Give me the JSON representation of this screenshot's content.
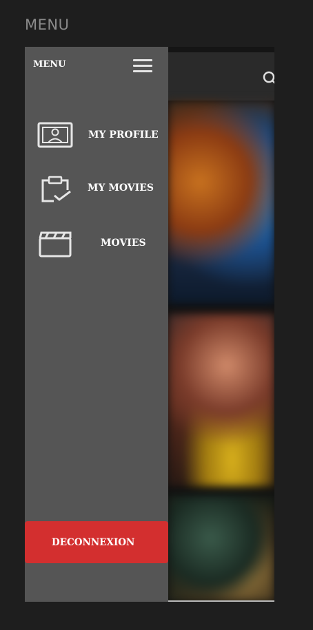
{
  "page": {
    "title": "MENU"
  },
  "drawer": {
    "title": "MENU",
    "items": [
      {
        "label": "MY PROFILE",
        "icon": "profile-card-icon"
      },
      {
        "label": "MY MOVIES",
        "icon": "clipboard-check-icon"
      },
      {
        "label": "MOVIES",
        "icon": "clapperboard-icon"
      }
    ],
    "logout_label": "DECONNEXION"
  },
  "colors": {
    "background": "#1e1e1e",
    "drawer": "#555555",
    "logout": "#d32f2f",
    "text": "#ffffff"
  }
}
